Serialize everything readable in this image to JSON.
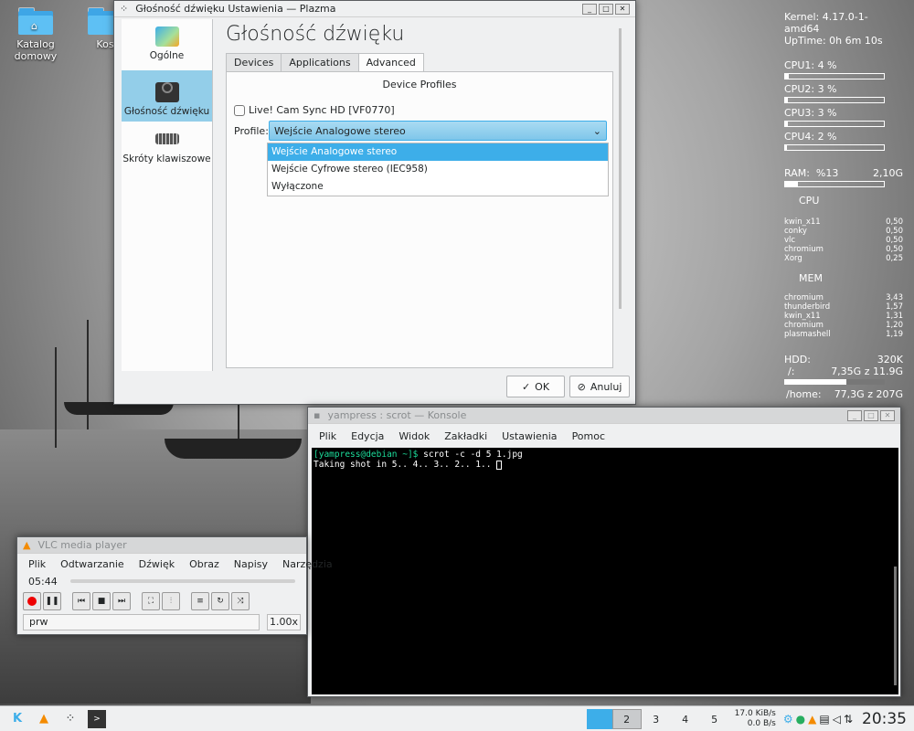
{
  "desktop": {
    "icons": [
      {
        "label": "Katalog domowy"
      },
      {
        "label": "Kos"
      }
    ]
  },
  "conky": {
    "kernel": "Kernel: 4.17.0-1-amd64",
    "uptime": "UpTime: 0h 6m 10s",
    "cpus": [
      {
        "label": "CPU1: 4 %",
        "level": 0.04
      },
      {
        "label": "CPU2: 3 %",
        "level": 0.03
      },
      {
        "label": "CPU3: 3 %",
        "level": 0.03
      },
      {
        "label": "CPU4: 2 %",
        "level": 0.02
      }
    ],
    "ram": {
      "label": "RAM:",
      "percent": "%13",
      "value": "2,10G",
      "level": 0.13
    },
    "cpu_header": "CPU",
    "cpu_procs": [
      [
        "kwin_x11",
        "0,50"
      ],
      [
        "conky",
        "0,50"
      ],
      [
        "vlc",
        "0,50"
      ],
      [
        "chromium",
        "0,50"
      ],
      [
        "Xorg",
        "0,25"
      ]
    ],
    "mem_header": "MEM",
    "mem_procs": [
      [
        "chromium",
        "3,43"
      ],
      [
        "thunderbird",
        "1,57"
      ],
      [
        "kwin_x11",
        "1,31"
      ],
      [
        "chromium",
        "1,20"
      ],
      [
        "plasmashell",
        "1,19"
      ]
    ],
    "hdd": {
      "label": "HDD:",
      "value": "320K",
      "root_label": "/:",
      "root_value": "7,35G z 11.9G",
      "root_level": 0.62,
      "home_label": "/home:",
      "home_value": "77,3G z 207G",
      "home_level": 0.37
    }
  },
  "settings": {
    "title": "Głośność dźwięku Ustawienia — Plazma",
    "sidebar": [
      {
        "label": "Ogólne"
      },
      {
        "label": "Głośność dźwięku"
      },
      {
        "label": "Skróty klawiszowe"
      }
    ],
    "page_title": "Głośność dźwięku",
    "tabs": [
      "Devices",
      "Applications",
      "Advanced"
    ],
    "device_profiles": "Device Profiles",
    "device_name": "Live! Cam Sync HD [VF0770]",
    "profile_label": "Profile:",
    "profile_selected": "Wejście Analogowe stereo",
    "profile_options": [
      "Wejście Analogowe stereo",
      "Wejście Cyfrowe stereo (IEC958)",
      "Wyłączone"
    ],
    "ok_label": "OK",
    "cancel_label": "Anuluj"
  },
  "konsole": {
    "title": "yampress : scrot — Konsole",
    "menu": [
      "Plik",
      "Edycja",
      "Widok",
      "Zakładki",
      "Ustawienia",
      "Pomoc"
    ],
    "prompt": "[yampress@debian ~]$",
    "command": " scrot -c -d 5 1.jpg",
    "output": "Taking shot in 5.. 4.. 3.. 2.. 1.. "
  },
  "vlc": {
    "title": "VLC media player",
    "menu": [
      "Plik",
      "Odtwarzanie",
      "Dźwięk",
      "Obraz",
      "Napisy",
      "Narzędzia"
    ],
    "time": "05:44",
    "playlist_text": "prw",
    "speed": "1.00x"
  },
  "taskbar": {
    "desktops": [
      "2",
      "3",
      "4",
      "5"
    ],
    "net_up": "17.0 KiB/s",
    "net_down": "0.0 B/s",
    "clock": "20:35"
  },
  "colors": {
    "accent": "#3daee9",
    "selection": "#93cee9"
  }
}
